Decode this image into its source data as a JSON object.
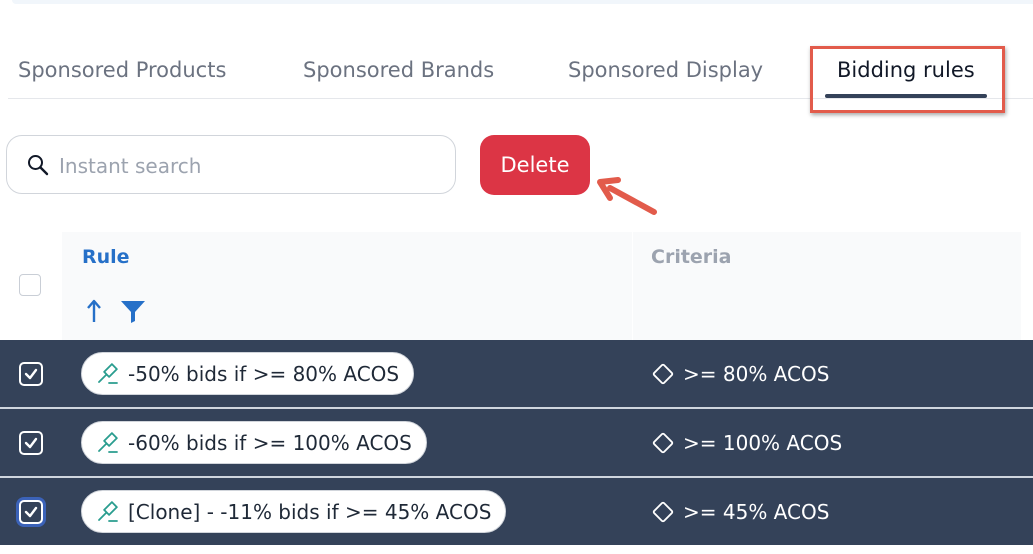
{
  "tabs": [
    {
      "label": "Sponsored Products",
      "active": false
    },
    {
      "label": "Sponsored Brands",
      "active": false
    },
    {
      "label": "Sponsored Display",
      "active": false
    },
    {
      "label": "Bidding rules",
      "active": true
    }
  ],
  "search": {
    "placeholder": "Instant search",
    "value": ""
  },
  "toolbar": {
    "delete_label": "Delete"
  },
  "table": {
    "columns": [
      {
        "label": "Rule",
        "sortable": true,
        "filterable": true
      },
      {
        "label": "Criteria"
      }
    ],
    "rows": [
      {
        "rule": "-50% bids if >= 80% ACOS",
        "criteria": ">= 80% ACOS",
        "checked": true
      },
      {
        "rule": "-60% bids if >= 100% ACOS",
        "criteria": ">= 100% ACOS",
        "checked": true
      },
      {
        "rule": "[Clone] - -11% bids if >= 45% ACOS",
        "criteria": ">= 45% ACOS",
        "checked": true
      }
    ]
  },
  "icons": {
    "search": "search-icon",
    "sort": "arrow-up-icon",
    "filter": "filter-icon",
    "rule": "gavel-icon",
    "criteria": "diamond-icon",
    "check": "checkmark-icon"
  },
  "colors": {
    "accent": "#2670c8",
    "danger": "#dc3545",
    "row_selected": "#344259",
    "annotation": "#e25b4b"
  }
}
